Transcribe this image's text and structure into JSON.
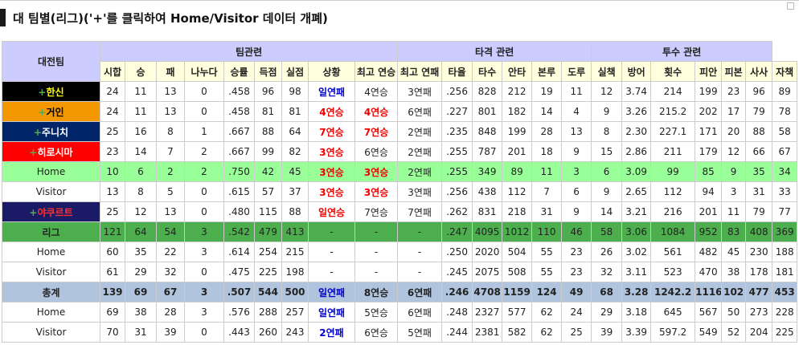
{
  "title": "대 팀별(리그)('+'를 클릭하여 Home/Visitor 데이터 개폐)",
  "colors": {
    "accent": "#1a1a1a",
    "group_header": "#ccccff",
    "sub_header": "#ffffdd",
    "home_row": "#99ff99",
    "league_row": "#4cae4c",
    "total_row": "#b0c4de",
    "win_streak": "#ee0000",
    "loss_streak": "#0000cc"
  },
  "corner_header": "대전팀",
  "groups": [
    {
      "label": "팀관련",
      "span": 9
    },
    {
      "label": "타격 관련",
      "span": 6
    },
    {
      "label": "투수 관련",
      "span": 6
    }
  ],
  "columns": [
    "시합",
    "승",
    "패",
    "나누다",
    "승률",
    "득점",
    "실점",
    "상황",
    "최고 연승",
    "최고 연패",
    "타율",
    "타수",
    "안타",
    "본루",
    "도루",
    "실책",
    "방어",
    "횟수",
    "피안",
    "피본",
    "사사",
    "자책"
  ],
  "rows": [
    {
      "name": "한신",
      "plus": "+",
      "bg": "#000000",
      "fg": "#ffff00",
      "style": "team",
      "cells": [
        "24",
        "11",
        "13",
        "0",
        ".458",
        "96",
        "98",
        "일연패",
        "4연승",
        "3연패",
        ".256",
        "828",
        "212",
        "19",
        "11",
        "12",
        "3.74",
        "214",
        "199",
        "23",
        "96",
        "89"
      ],
      "status": "loss"
    },
    {
      "name": "거인",
      "plus": "+",
      "bg": "#f39800",
      "fg": "#000000",
      "style": "team",
      "cells": [
        "24",
        "11",
        "13",
        "0",
        ".458",
        "81",
        "81",
        "4연승",
        "4연승",
        "6연패",
        ".227",
        "801",
        "182",
        "14",
        "4",
        "9",
        "3.26",
        "215.2",
        "202",
        "17",
        "79",
        "78"
      ],
      "status": "win",
      "best_win_red": true
    },
    {
      "name": "주니치",
      "plus": "+",
      "bg": "#002569",
      "fg": "#ffffff",
      "style": "team",
      "cells": [
        "25",
        "16",
        "8",
        "1",
        ".667",
        "88",
        "64",
        "7연승",
        "7연승",
        "2연패",
        ".235",
        "848",
        "199",
        "28",
        "13",
        "8",
        "2.30",
        "227.1",
        "171",
        "20",
        "88",
        "58"
      ],
      "status": "win",
      "best_win_red": true
    },
    {
      "name": "히로시마",
      "plus": "+",
      "bg": "#ff0000",
      "fg": "#ffffff",
      "style": "team",
      "cells": [
        "23",
        "14",
        "7",
        "2",
        ".667",
        "99",
        "82",
        "3연승",
        "6연승",
        "2연패",
        ".255",
        "787",
        "201",
        "18",
        "9",
        "15",
        "2.86",
        "211",
        "179",
        "12",
        "66",
        "67"
      ],
      "status": "win"
    },
    {
      "name": "Home",
      "plus": "",
      "bg": "",
      "fg": "",
      "style": "home",
      "cells": [
        "10",
        "6",
        "2",
        "2",
        ".750",
        "42",
        "45",
        "3연승",
        "3연승",
        "2연패",
        ".255",
        "349",
        "89",
        "11",
        "3",
        "6",
        "3.09",
        "99",
        "85",
        "9",
        "35",
        "34"
      ],
      "status": "win",
      "best_win_red": true
    },
    {
      "name": "Visitor",
      "plus": "",
      "bg": "",
      "fg": "",
      "style": "plain",
      "cells": [
        "13",
        "8",
        "5",
        "0",
        ".615",
        "57",
        "37",
        "3연승",
        "3연승",
        "3연패",
        ".256",
        "438",
        "112",
        "7",
        "6",
        "9",
        "2.65",
        "112",
        "94",
        "3",
        "31",
        "33"
      ],
      "status": "win",
      "best_win_red": true
    },
    {
      "name": "야쿠르트",
      "plus": "+",
      "bg": "#1a1a66",
      "fg": "#ff3333",
      "style": "team",
      "cells": [
        "25",
        "12",
        "13",
        "0",
        ".480",
        "115",
        "88",
        "일연승",
        "7연승",
        "7연패",
        ".262",
        "831",
        "218",
        "31",
        "9",
        "14",
        "3.21",
        "216",
        "201",
        "11",
        "79",
        "77"
      ],
      "status": "win"
    },
    {
      "name": "리그",
      "plus": "",
      "bg": "",
      "fg": "",
      "style": "league",
      "cells": [
        "121",
        "64",
        "54",
        "3",
        ".542",
        "479",
        "413",
        "-",
        "-",
        "-",
        ".247",
        "4095",
        "1012",
        "110",
        "46",
        "58",
        "3.06",
        "1084",
        "952",
        "83",
        "408",
        "369"
      ],
      "status": "none"
    },
    {
      "name": "Home",
      "plus": "",
      "bg": "",
      "fg": "",
      "style": "plain",
      "cells": [
        "60",
        "35",
        "22",
        "3",
        ".614",
        "254",
        "215",
        "-",
        "-",
        "-",
        ".250",
        "2020",
        "504",
        "55",
        "23",
        "26",
        "3.02",
        "561",
        "482",
        "45",
        "230",
        "188"
      ],
      "status": "none"
    },
    {
      "name": "Visitor",
      "plus": "",
      "bg": "",
      "fg": "",
      "style": "plain",
      "cells": [
        "61",
        "29",
        "32",
        "0",
        ".475",
        "225",
        "198",
        "-",
        "-",
        "-",
        ".245",
        "2075",
        "508",
        "55",
        "23",
        "32",
        "3.11",
        "523",
        "470",
        "38",
        "178",
        "181"
      ],
      "status": "none"
    },
    {
      "name": "총계",
      "plus": "",
      "bg": "",
      "fg": "",
      "style": "total",
      "cells": [
        "139",
        "69",
        "67",
        "3",
        ".507",
        "544",
        "500",
        "일연패",
        "8연승",
        "6연패",
        ".246",
        "4708",
        "1159",
        "124",
        "49",
        "68",
        "3.28",
        "1242.2",
        "1116",
        "102",
        "477",
        "453"
      ],
      "status": "loss"
    },
    {
      "name": "Home",
      "plus": "",
      "bg": "",
      "fg": "",
      "style": "plain",
      "cells": [
        "69",
        "38",
        "28",
        "3",
        ".576",
        "288",
        "257",
        "일연패",
        "5연승",
        "6연패",
        ".248",
        "2327",
        "577",
        "62",
        "24",
        "29",
        "3.18",
        "645",
        "567",
        "50",
        "273",
        "228"
      ],
      "status": "loss"
    },
    {
      "name": "Visitor",
      "plus": "",
      "bg": "",
      "fg": "",
      "style": "plain",
      "cells": [
        "70",
        "31",
        "39",
        "0",
        ".443",
        "260",
        "243",
        "2연패",
        "6연승",
        "5연패",
        ".244",
        "2381",
        "582",
        "62",
        "25",
        "39",
        "3.39",
        "597.2",
        "549",
        "52",
        "204",
        "225"
      ],
      "status": "loss"
    }
  ]
}
